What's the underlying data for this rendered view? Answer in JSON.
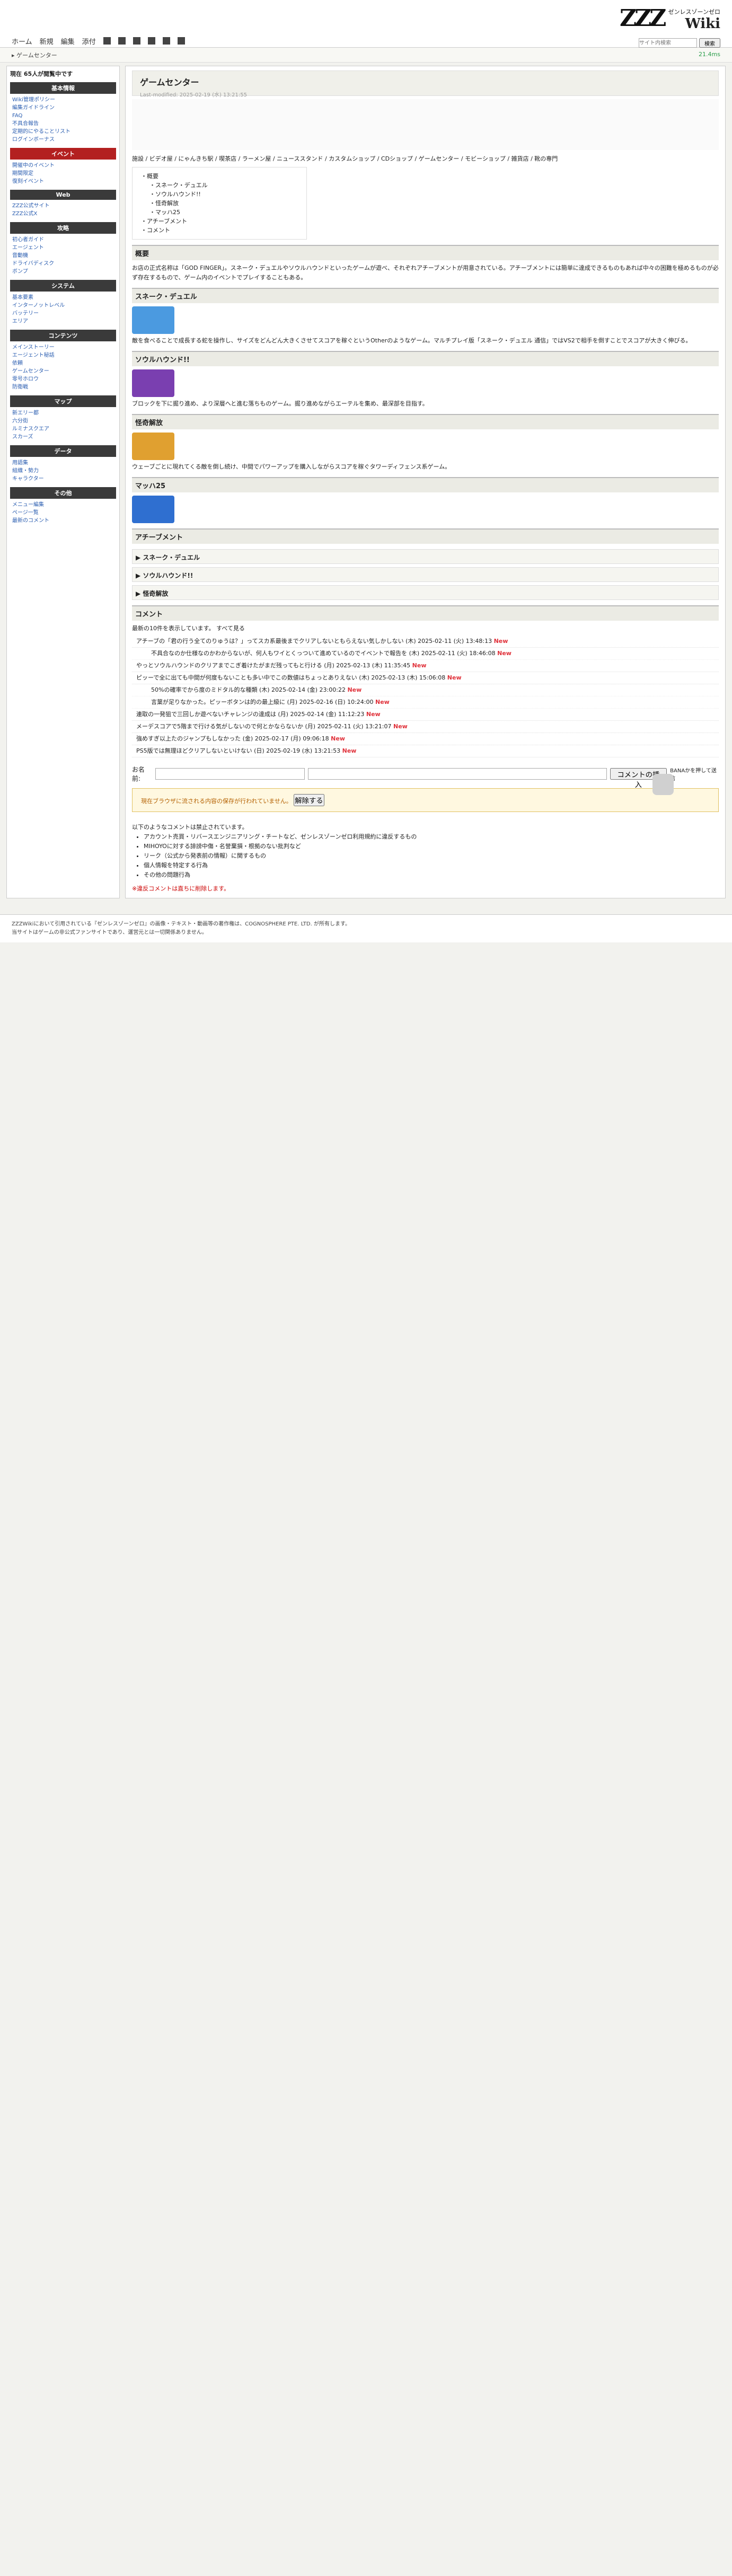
{
  "topnav": {
    "items": [
      "ホーム",
      "新規",
      "編集",
      "添付"
    ]
  },
  "logo": {
    "text": "ZZZ",
    "sub": "ゼンレスゾーンゼロ",
    "wiki": "Wiki"
  },
  "search": {
    "placeholder": "サイト内検索",
    "button": "検索"
  },
  "breadcrumb": {
    "path": "▸ ゲームセンター",
    "counter": "21.4ms"
  },
  "sidebar": {
    "stat": "現在 65人が閲覧中です",
    "sections": [
      {
        "title": "基本情報",
        "red": false,
        "items": [
          "Wiki管理ポリシー",
          "編集ガイドライン",
          "FAQ",
          "不具合報告",
          "定期的にやることリスト",
          "ログインボーナス"
        ]
      },
      {
        "title": "イベント",
        "red": true,
        "items": [
          "開催中のイベント",
          "期間限定",
          "復刻イベント"
        ]
      },
      {
        "title": "Web",
        "red": false,
        "items": [
          "ZZZ公式サイト",
          "ZZZ公式X"
        ]
      },
      {
        "title": "攻略",
        "red": false,
        "items": [
          "初心者ガイド",
          "エージェント",
          "音動機",
          "ドライバディスク",
          "ボンプ"
        ]
      },
      {
        "title": "システム",
        "red": false,
        "items": [
          "基本要素",
          "インターノットレベル",
          "バッテリー",
          "エリア"
        ]
      },
      {
        "title": "コンテンツ",
        "red": false,
        "items": [
          "メインストーリー",
          "エージェント秘話",
          "依頼",
          "ゲームセンター",
          "零号ホロウ",
          "防衛戦"
        ]
      },
      {
        "title": "マップ",
        "red": false,
        "items": [
          "新エリー都",
          "六分街",
          "ルミナスクエア",
          "スカーズ"
        ]
      },
      {
        "title": "データ",
        "red": false,
        "items": [
          "用語集",
          "組織・勢力",
          "キャラクター"
        ]
      },
      {
        "title": "その他",
        "red": false,
        "items": [
          "メニュー編集",
          "ページ一覧",
          "最新のコメント"
        ]
      }
    ]
  },
  "page": {
    "title": "ゲームセンター",
    "date": "Last-modified: 2025-02-19 (水) 13:21:55",
    "tags": "施設 / ビデオ屋 / にゃんきち駅 / 喫茶店 / ラーメン屋 / ニューススタンド / カスタムショップ / CDショップ / ゲームセンター / モビーショップ / 雑貨店 / 靴の専門",
    "toc": [
      "概要",
      "スネーク・デュエル",
      "ソウルハウンド!!",
      "怪奇解放",
      "マッハ25",
      "アチーブメント",
      "コメント"
    ]
  },
  "sections": [
    {
      "heading": "概要",
      "text": "お店の正式名称は「GOD FINGER」。スネーク・デュエルやソウルハウンドといったゲームが遊べ、それぞれアチーブメントが用意されている。アチーブメントには簡単に達成できるものもあれば中々の困難を極めるものが必ず存在するもので、ゲーム内のイベントでプレイすることもある。"
    },
    {
      "heading": "スネーク・デュエル",
      "text": "敵を食べることで成長する蛇を操作し、サイズをどんどん大きくさせてスコアを稼ぐというOtherのようなゲーム。マルチプレイ版「スネーク・デュエル 通信」ではVS2で相手を倒すことでスコアが大きく伸びる。"
    },
    {
      "heading": "ソウルハウンド!!",
      "text": "ブロックを下に掘り進め、より深層へと進む落ちものゲーム。掘り進めながらエーテルを集め、最深部を目指す。"
    },
    {
      "heading": "怪奇解放",
      "text": "ウェーブごとに現れてくる敵を倒し続け、中間でパワーアップを購入しながらスコアを稼ぐタワーディフェンス系ゲーム。"
    },
    {
      "heading": "マッハ25",
      "text": ""
    },
    {
      "heading": "アチーブメント",
      "text": ""
    }
  ],
  "achievements": [
    "スネーク・デュエル",
    "ソウルハウンド!!",
    "怪奇解放"
  ],
  "comments": {
    "heading": "コメント",
    "note": "最新の10件を表示しています。 すべて見る",
    "items": [
      {
        "reply": false,
        "text": "アチーブの「君の行う全てのりゅうは？」ってスカ系最後までクリアしないともらえない気しかしない",
        "date": "(木) 2025-02-11 (火) 13:48:13"
      },
      {
        "reply": true,
        "text": "不具合なのか仕様なのかわからないが、何人もワイとくっついて進めているのでイベントで報告を",
        "date": "(木) 2025-02-11 (火) 18:46:08"
      },
      {
        "reply": false,
        "text": "やっとソウルハウンドのクリアまでこぎ着けたがまだ残ってもと行ける",
        "date": "(月) 2025-02-13 (木) 11:35:45"
      },
      {
        "reply": false,
        "text": "ピッーで全に出ても中間が何度もないことも多い中でこの数値はちょっとありえない",
        "date": "(木) 2025-02-13 (木) 15:06:08"
      },
      {
        "reply": true,
        "text": "50%の確率でから度のミドタル的な種類",
        "date": "(木) 2025-02-14 (金) 23:00:22"
      },
      {
        "reply": true,
        "text": "言葉が足りなかった。ピッーボタンは的の最上級に",
        "date": "(月) 2025-02-16 (日) 10:24:00"
      },
      {
        "reply": false,
        "text": "連取の一発狙で三回しか遊べないチャレンジの達成は",
        "date": "(月) 2025-02-14 (金) 11:12:23"
      },
      {
        "reply": false,
        "text": "メーデスコアで5階まで行ける気がしないので何とかならないか",
        "date": "(月) 2025-02-11 (火) 13:21:07"
      },
      {
        "reply": false,
        "text": "強めすぎ以上たのジャンプもしなかった",
        "date": "(金) 2025-02-17 (月) 09:06:18"
      },
      {
        "reply": false,
        "text": "PS5版では無理ほどクリアしないといけない",
        "date": "(日) 2025-02-19 (水) 13:21:53"
      }
    ]
  },
  "form": {
    "name_label": "お名前:",
    "submit": "コメントの挿入",
    "checkbox": "BANAかを押して送信"
  },
  "warning": {
    "text": "現在ブラウザに流される内容の保存が行われていません。",
    "button": "解除する"
  },
  "notice": {
    "intro": "以下のようなコメントは禁止されています。",
    "rules": [
      "アカウント売買・リバースエンジニアリング・チートなど、ゼンレスゾーンゼロ利用規約に違反するもの",
      "MIHOYOに対する誹謗中傷・名誉棄損・根拠のない批判など",
      "リーク（公式から発表前の情報）に関するもの",
      "個人情報を特定する行為",
      "その他の問題行為"
    ],
    "footer": "※違反コメントは直ちに削除します。"
  },
  "footer": {
    "line1": "ZZZWikiにおいて引用されている『ゼンレスゾーンゼロ』の画像・テキスト・動画等の著作権は、COGNOSPHERE PTE. LTD. が所有します。",
    "line2": "当サイトはゲームの非公式ファンサイトであり、運営元とは一切関係ありません。"
  },
  "colors": {
    "accent": "#2a5db0",
    "header_dark": "#3a3a3a",
    "new_red": "#e0313a"
  }
}
